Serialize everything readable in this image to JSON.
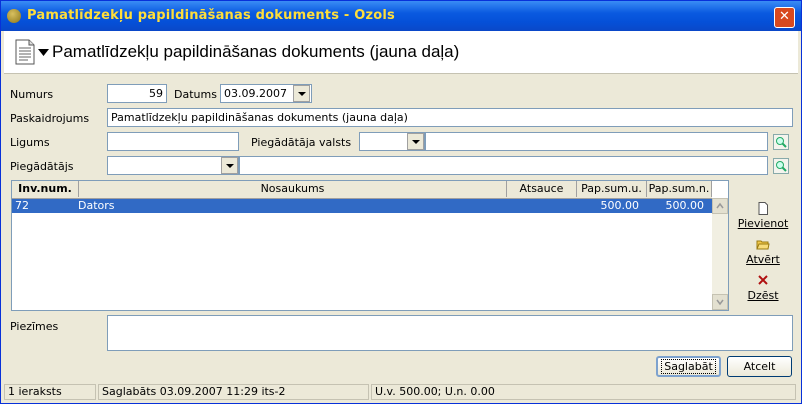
{
  "window": {
    "title": "Pamatlīdzekļu papildināšanas dokuments - Ozols",
    "close_label": "✕"
  },
  "header": {
    "title": "Pamatlīdzekļu papildināšanas dokuments (jauna daļa)"
  },
  "form": {
    "numurs_label": "Numurs",
    "numurs_value": "59",
    "datums_label": "Datums",
    "datums_value": "03.09.2007",
    "paskaidrojums_label": "Paskaidrojums",
    "paskaidrojums_value": "Pamatlīdzekļu papildināšanas dokuments (jauna daļa)",
    "ligums_label": "Ligums",
    "ligums_value": "",
    "valsts_label": "Piegādātāja valsts",
    "valsts_value": "",
    "valsts_name": "",
    "piegadatajs_label": "Piegādātājs",
    "piegadatajs_value": "",
    "piegadatajs_name": ""
  },
  "table": {
    "columns": [
      "Inv.num.",
      "Nosaukums",
      "Atsauce",
      "Pap.sum.u.",
      "Pap.sum.n."
    ],
    "rows": [
      {
        "inv": "72",
        "nosaukums": "Dators",
        "atsauce": "",
        "sum_u": "500.00",
        "sum_n": "500.00"
      }
    ]
  },
  "side_buttons": {
    "add": "Pievienot",
    "open": "Atvērt",
    "delete": "Dzēst"
  },
  "notes": {
    "label": "Piezīmes",
    "value": ""
  },
  "buttons": {
    "save": "Saglabāt",
    "cancel": "Atcelt"
  },
  "status": {
    "count": "1 ieraksts",
    "saved": "Saglabāts 03.09.2007 11:29 its-2",
    "sums": "U.v. 500.00; U.n. 0.00"
  },
  "colors": {
    "title_text": "#ffde3a",
    "selection": "#316ac5",
    "titlebar": "#0a5ae0"
  }
}
